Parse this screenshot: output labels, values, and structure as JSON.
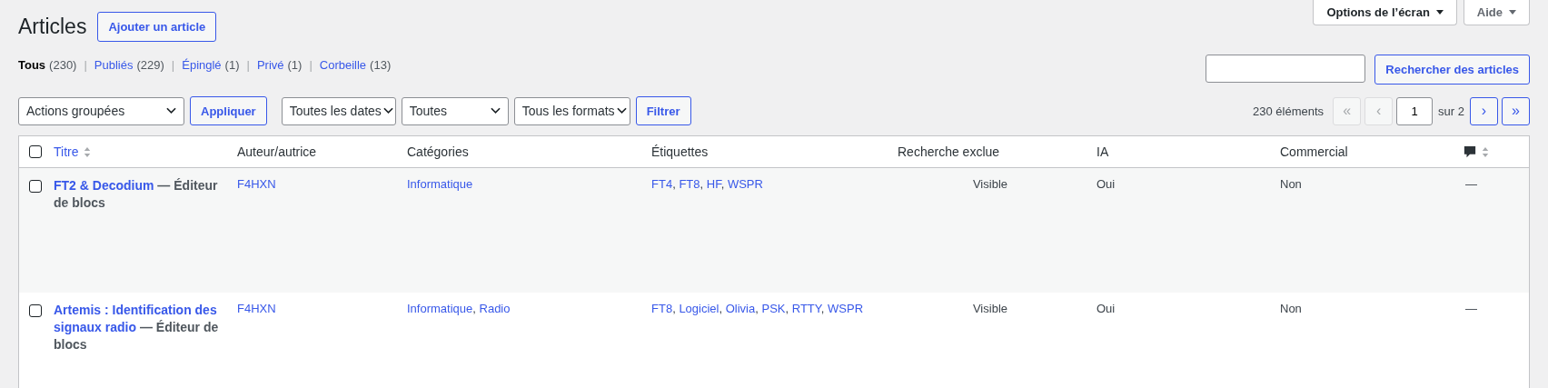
{
  "page_title": "Articles",
  "add_button": "Ajouter un article",
  "screen_buttons": [
    "Options de l’écran",
    "Aide"
  ],
  "view_separator": "|",
  "views": [
    {
      "label": "Tous",
      "count": "(230)",
      "selected": true
    },
    {
      "label": "Publiés",
      "count": "(229)",
      "selected": false
    },
    {
      "label": "Épinglé",
      "count": "(1)",
      "selected": false
    },
    {
      "label": "Privé",
      "count": "(1)",
      "selected": false
    },
    {
      "label": "Corbeille",
      "count": "(13)",
      "selected": false
    }
  ],
  "search": {
    "button": "Rechercher des articles"
  },
  "bulk_actions": {
    "value": "Actions groupées",
    "button": "Appliquer"
  },
  "filters": [
    {
      "value": "Toutes les dates"
    },
    {
      "value": "Toutes"
    },
    {
      "value": "Tous les formats"
    }
  ],
  "filter_button": "Filtrer",
  "pagination": {
    "count": "230 éléments",
    "first": "«",
    "prev": "‹",
    "page": "1",
    "total": "sur 2",
    "next": "›",
    "last": "»"
  },
  "table": {
    "columns": [
      {
        "label": "Titre",
        "sortable": true,
        "kind": "link"
      },
      {
        "label": "Auteur/autrice",
        "sortable": false,
        "kind": "text"
      },
      {
        "label": "Catégories",
        "sortable": false,
        "kind": "text"
      },
      {
        "label": "Étiquettes",
        "sortable": false,
        "kind": "text"
      },
      {
        "label": "Recherche exclue",
        "sortable": false,
        "kind": "text"
      },
      {
        "label": "IA",
        "sortable": false,
        "kind": "text"
      },
      {
        "label": "Commercial",
        "sortable": false,
        "kind": "text"
      },
      {
        "sortable": true,
        "kind": "comments"
      }
    ],
    "select_all_checked": false,
    "list_separator": ",",
    "rows": [
      {
        "checked": false,
        "title": "FT2 & Decodium",
        "state": "— Éditeur de blocs",
        "author": "F4HXN",
        "categories": [
          "Informatique"
        ],
        "tags": [
          "FT4",
          "FT8",
          "HF",
          "WSPR"
        ],
        "search_excluded": "Visible",
        "ia": "Oui",
        "commercial": "Non",
        "comments": "—"
      },
      {
        "checked": false,
        "title": "Artemis : Identification des signaux radio",
        "state": "— Éditeur de blocs",
        "author": "F4HXN",
        "categories": [
          "Informatique",
          "Radio"
        ],
        "tags": [
          "FT8",
          "Logiciel",
          "Olivia",
          "PSK",
          "RTTY",
          "WSPR"
        ],
        "search_excluded": "Visible",
        "ia": "Oui",
        "commercial": "Non",
        "comments": "—"
      }
    ]
  }
}
